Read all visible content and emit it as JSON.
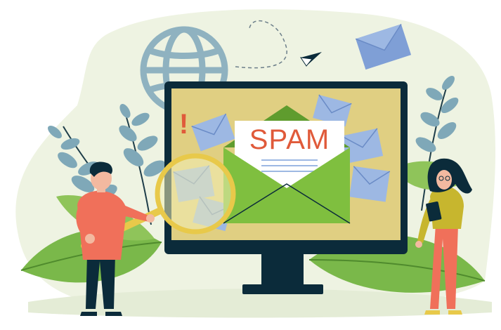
{
  "illustration": {
    "letter_text": "SPAM",
    "warning_mark": "!",
    "colors": {
      "background_blob": "#eef3e2",
      "monitor_frame": "#0b2b3a",
      "screen": "#e0cf82",
      "envelope_green": "#7fbf3f",
      "envelope_blue": "#9db8e3",
      "spam_red": "#e05a3a",
      "leaf_green": "#7ab84a",
      "leaf_blue": "#7fa8b8",
      "magnifier_gold": "#e8c94a"
    },
    "icons": [
      "globe-icon",
      "paper-plane-icon",
      "envelope-icon",
      "magnifier-icon",
      "exclamation-icon",
      "tablet-icon"
    ]
  }
}
